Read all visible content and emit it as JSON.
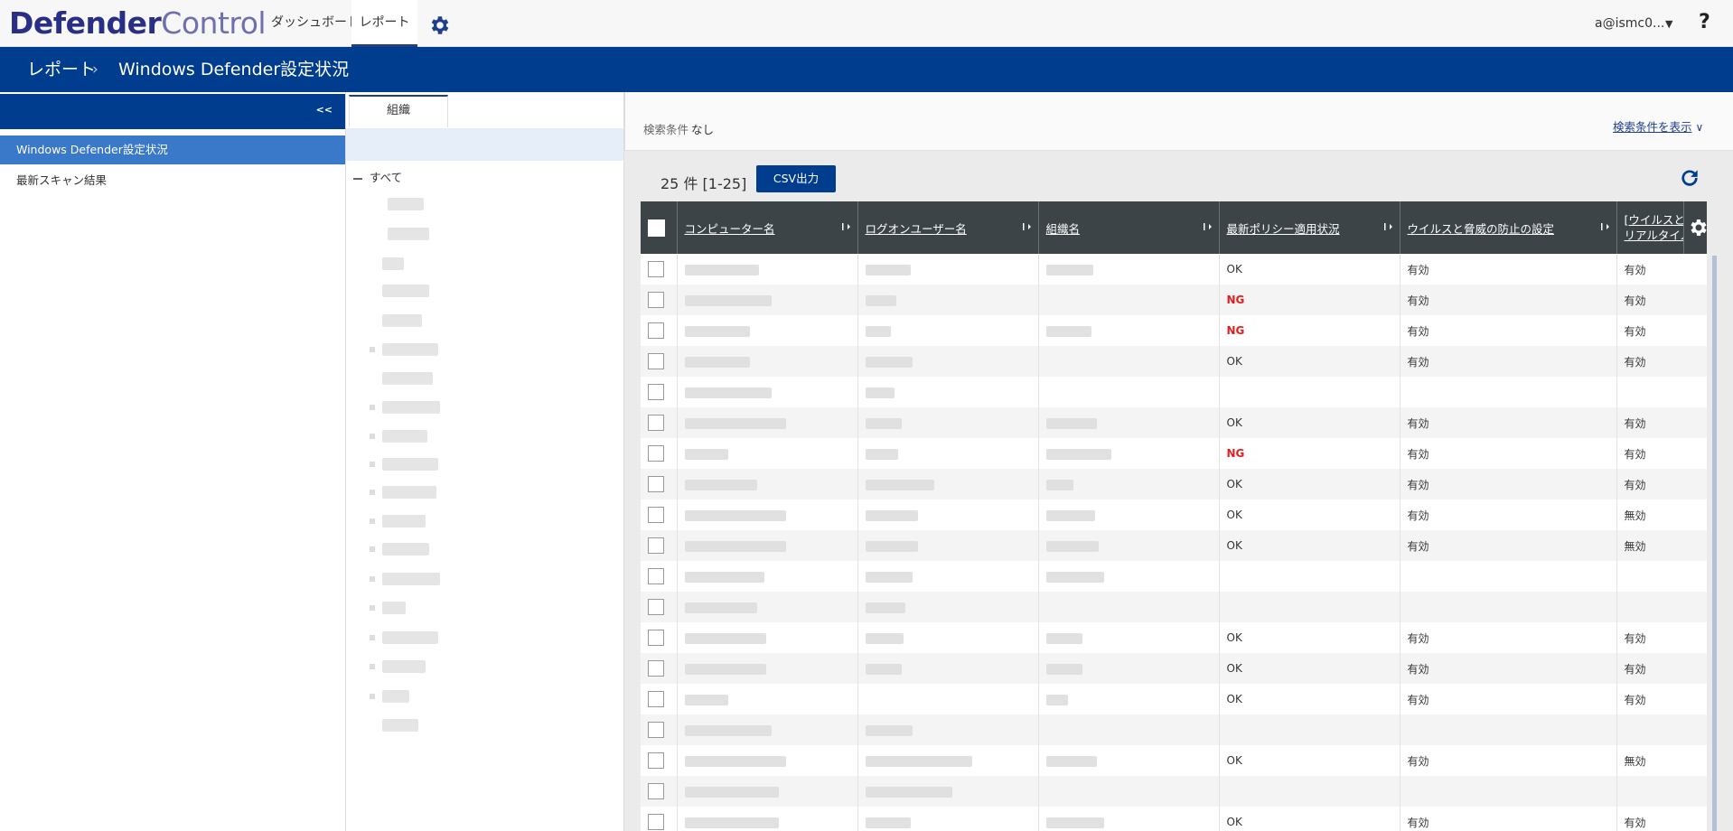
{
  "app": {
    "logo_part1": "Defender",
    "logo_part2": "Control"
  },
  "nav": {
    "dashboard": "ダッシュボード",
    "report": "レポート",
    "user": "a@ismc0...",
    "help": "?"
  },
  "breadcrumb": {
    "parent": "レポート",
    "sep": ">",
    "current": "Windows Defender設定状況"
  },
  "sidemenu": {
    "collapse": "<<",
    "items": [
      "Windows Defender設定状況",
      "最新スキャン結果"
    ]
  },
  "orgtree": {
    "tab": "組織",
    "root": "すべて"
  },
  "search": {
    "label": "検索条件",
    "value": "なし",
    "show": "検索条件を表示"
  },
  "results": {
    "count": "25 件 [1-25]",
    "csv": "CSV出力"
  },
  "table": {
    "headers": [
      "コンピューター名",
      "ログオンユーザー名",
      "組織名",
      "最新ポリシー適用状況",
      "ウイルスと脅威の防止の設定",
      "[ウイルスと脅威\nリアルタイム保"
    ],
    "header_6a": "[ウイルスと脅威",
    "header_6b": "リアルタイム保",
    "rows": [
      {
        "policy": "OK",
        "av": "有効",
        "rt": "有効"
      },
      {
        "policy": "NG",
        "av": "有効",
        "rt": "有効"
      },
      {
        "policy": "NG",
        "av": "有効",
        "rt": "有効"
      },
      {
        "policy": "OK",
        "av": "有効",
        "rt": "有効"
      },
      {
        "policy": "",
        "av": "",
        "rt": ""
      },
      {
        "policy": "OK",
        "av": "有効",
        "rt": "有効"
      },
      {
        "policy": "NG",
        "av": "有効",
        "rt": "有効"
      },
      {
        "policy": "OK",
        "av": "有効",
        "rt": "有効"
      },
      {
        "policy": "OK",
        "av": "有効",
        "rt": "無効"
      },
      {
        "policy": "OK",
        "av": "有効",
        "rt": "無効"
      },
      {
        "policy": "",
        "av": "",
        "rt": ""
      },
      {
        "policy": "",
        "av": "",
        "rt": ""
      },
      {
        "policy": "OK",
        "av": "有効",
        "rt": "有効"
      },
      {
        "policy": "OK",
        "av": "有効",
        "rt": "有効"
      },
      {
        "policy": "OK",
        "av": "有効",
        "rt": "有効"
      },
      {
        "policy": "",
        "av": "",
        "rt": ""
      },
      {
        "policy": "OK",
        "av": "有効",
        "rt": "無効"
      },
      {
        "policy": "",
        "av": "",
        "rt": ""
      },
      {
        "policy": "OK",
        "av": "有効",
        "rt": "有効"
      }
    ]
  },
  "colors": {
    "brand": "#003d8f",
    "ng": "#e02020",
    "header": "#3d4448"
  }
}
